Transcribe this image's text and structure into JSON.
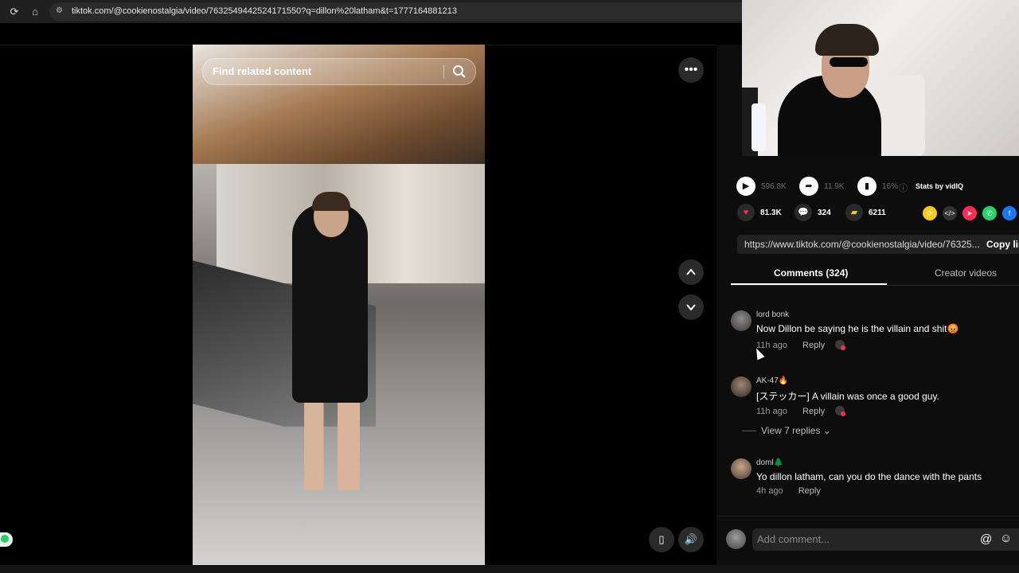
{
  "browser": {
    "url": "tiktok.com/@cookienostalgia/video/7632549442524171550?q=dillon%20latham&t=1777164881213"
  },
  "player": {
    "search_placeholder": "Find related content"
  },
  "stats": {
    "views": "596.8K",
    "shares": "11.9K",
    "engagement": "16%",
    "provider": "Stats by vidIQ",
    "likes": "81.3K",
    "comments": "324",
    "saves": "6211"
  },
  "link_bar": {
    "url": "https://www.tiktok.com/@cookienostalgia/video/76325...",
    "copy_label": "Copy lin"
  },
  "tabs": [
    {
      "label": "Comments (324)",
      "active": true
    },
    {
      "label": "Creator videos",
      "active": false
    }
  ],
  "comments": [
    {
      "user": "lord bonk",
      "text": "Now Dillon be saying he is the villain and shit😡",
      "time": "11h ago",
      "reply": "Reply"
    },
    {
      "user": "AK-47🔥",
      "text": "[ステッカー] A villain was once a good guy.",
      "time": "11h ago",
      "reply": "Reply",
      "view_replies": "View 7 replies"
    },
    {
      "user": "doml🌲",
      "text": "Yo dillon latham, can you do the dance with the pants",
      "time": "4h ago",
      "reply": "Reply"
    }
  ],
  "comment_box": {
    "placeholder": "Add comment..."
  },
  "colors": {
    "accent": "#fe2c55",
    "save": "#facc15",
    "whatsapp": "#25d366",
    "facebook": "#1877f2"
  }
}
